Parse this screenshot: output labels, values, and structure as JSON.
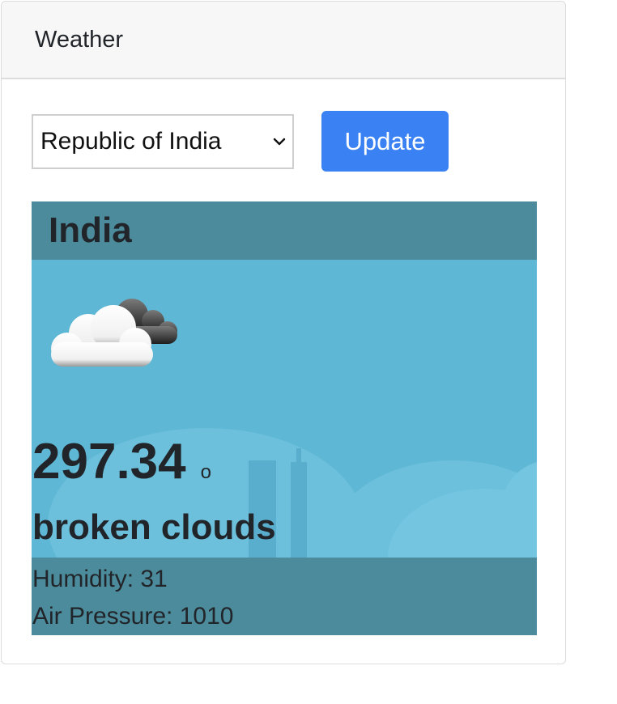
{
  "card": {
    "title": "Weather"
  },
  "controls": {
    "selected_country": "Republic of India",
    "update_label": "Update"
  },
  "weather": {
    "country": "India",
    "icon": "broken-clouds-icon",
    "temperature": "297.34",
    "degree_symbol": "o",
    "description": "broken clouds",
    "humidity_label": "Humidity: 31",
    "pressure_label": "Air Pressure: 1010"
  },
  "colors": {
    "header_bg": "#f7f7f7",
    "button_bg": "#3a81f4",
    "weather_bg": "#5eb8d5",
    "weather_band": "#4c8b9b"
  }
}
